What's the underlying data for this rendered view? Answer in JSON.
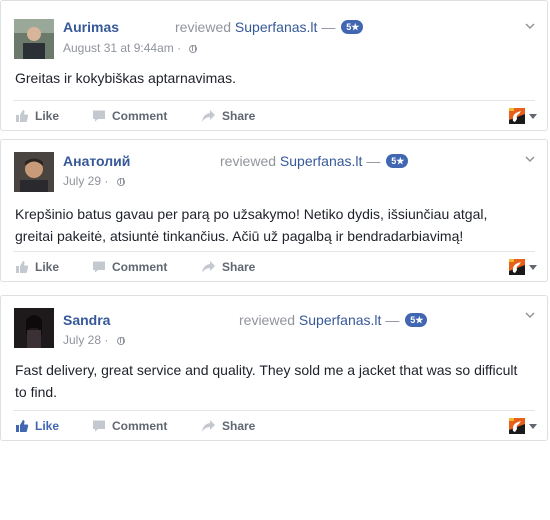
{
  "reviews": [
    {
      "author": "Aurimas",
      "verb": "reviewed",
      "page": "Superfanas.lt",
      "separator": "—",
      "rating": "5★",
      "date": "August 31 at 9:44am",
      "date_sep": "·",
      "text": "Greitas ir kokybiškas aptarnavimas.",
      "actions": {
        "like": "Like",
        "comment": "Comment",
        "share": "Share"
      },
      "liked": false
    },
    {
      "author": "Анатолий",
      "verb": "reviewed",
      "page": "Superfanas.lt",
      "separator": "—",
      "rating": "5★",
      "date": "July 29",
      "date_sep": "·",
      "text": "Krepšinio batus gavau per parą po užsakymo! Netiko dydis, išsiunčiau atgal, greitai pakeitė, atsiuntė tinkančius. Ačiū už pagalbą ir bendradarbiavimą!",
      "actions": {
        "like": "Like",
        "comment": "Comment",
        "share": "Share"
      },
      "liked": false
    },
    {
      "author": "Sandra",
      "verb": "reviewed",
      "page": "Superfanas.lt",
      "separator": "—",
      "rating": "5★",
      "date": "July 28",
      "date_sep": "·",
      "text": "Fast delivery, great service and quality. They sold me a jacket that was so difficult to find.",
      "actions": {
        "like": "Like",
        "comment": "Comment",
        "share": "Share"
      },
      "liked": true
    }
  ],
  "colors": {
    "link": "#365899",
    "muted": "#90949c",
    "badge": "#4267b2",
    "action": "#606770",
    "liked": "#4267b2"
  },
  "icons": {
    "like": "thumbs-up-icon",
    "comment": "comment-icon",
    "share": "share-arrow-icon",
    "privacy": "globe-icon",
    "menu": "chevron-down-icon",
    "page_avatar": "superfanas-logo-icon"
  }
}
